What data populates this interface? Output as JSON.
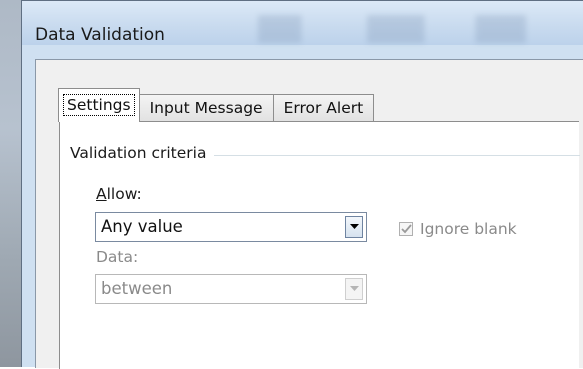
{
  "window": {
    "title": "Data Validation"
  },
  "tabs": [
    {
      "label": "Settings"
    },
    {
      "label": "Input Message"
    },
    {
      "label": "Error Alert"
    }
  ],
  "settings": {
    "group_label": "Validation criteria",
    "allow": {
      "label_underlined": "A",
      "label_rest": "llow:",
      "value": "Any value"
    },
    "ignore_blank": {
      "label": "Ignore blank",
      "checked": true,
      "disabled": true
    },
    "data": {
      "label": "Data:",
      "value": "between",
      "disabled": true
    }
  },
  "icons": {
    "dropdown": "chevron-down-icon",
    "check": "check-icon"
  }
}
